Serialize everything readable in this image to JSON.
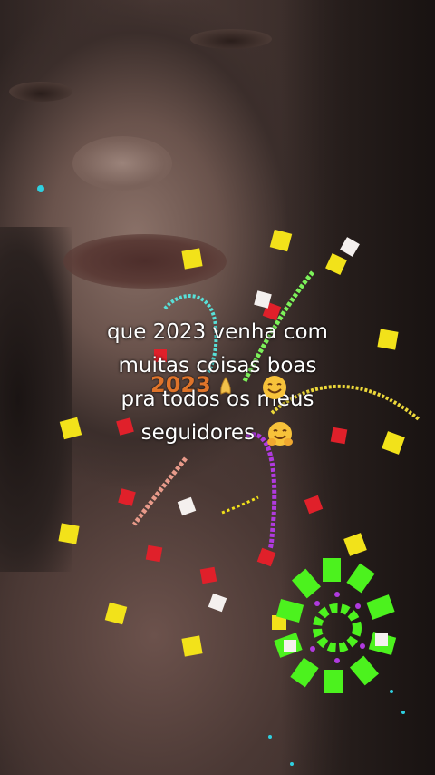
{
  "caption": {
    "line1": "que 2023 venha com",
    "line2": "muitas coisas boas",
    "line3": "pra todos os meus",
    "line4": "seguidores"
  },
  "sticker_year": "2023",
  "icons": {
    "line3_emoji": "smiling-face-icon",
    "line4_emoji": "hugging-face-icon",
    "sticker_emoji": "praying-hands-icon"
  },
  "colors": {
    "caption_text": "#ffffff",
    "confetti_yellow": "#f2e21a",
    "confetti_red": "#e0202a",
    "firework_green": "#4cf21e",
    "firework_purple": "#b03adf",
    "firework_cyan": "#58e0d8",
    "sticker_orange": "#e0742a"
  }
}
